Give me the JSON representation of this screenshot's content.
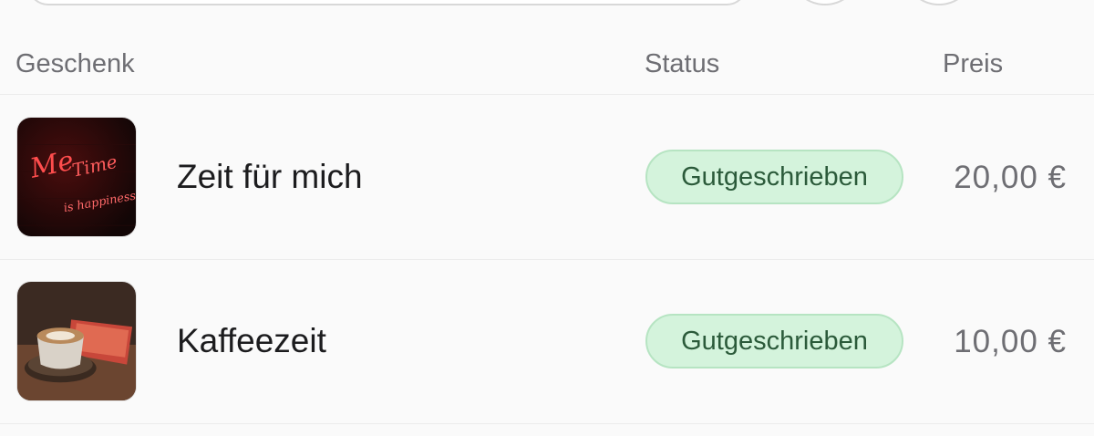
{
  "table": {
    "headers": {
      "gift": "Geschenk",
      "status": "Status",
      "price": "Preis"
    },
    "rows": [
      {
        "name": "Zeit für mich",
        "status": "Gutgeschrieben",
        "price": "20,00 €",
        "image_icon": "neon-sign-image",
        "image_text": "Me Time is happiness"
      },
      {
        "name": "Kaffeezeit",
        "status": "Gutgeschrieben",
        "price": "10,00 €",
        "image_icon": "coffee-cup-image"
      }
    ]
  },
  "colors": {
    "badge_bg": "#d4f3dc",
    "badge_text": "#2b5a3a",
    "muted_text": "#6e6e73"
  }
}
